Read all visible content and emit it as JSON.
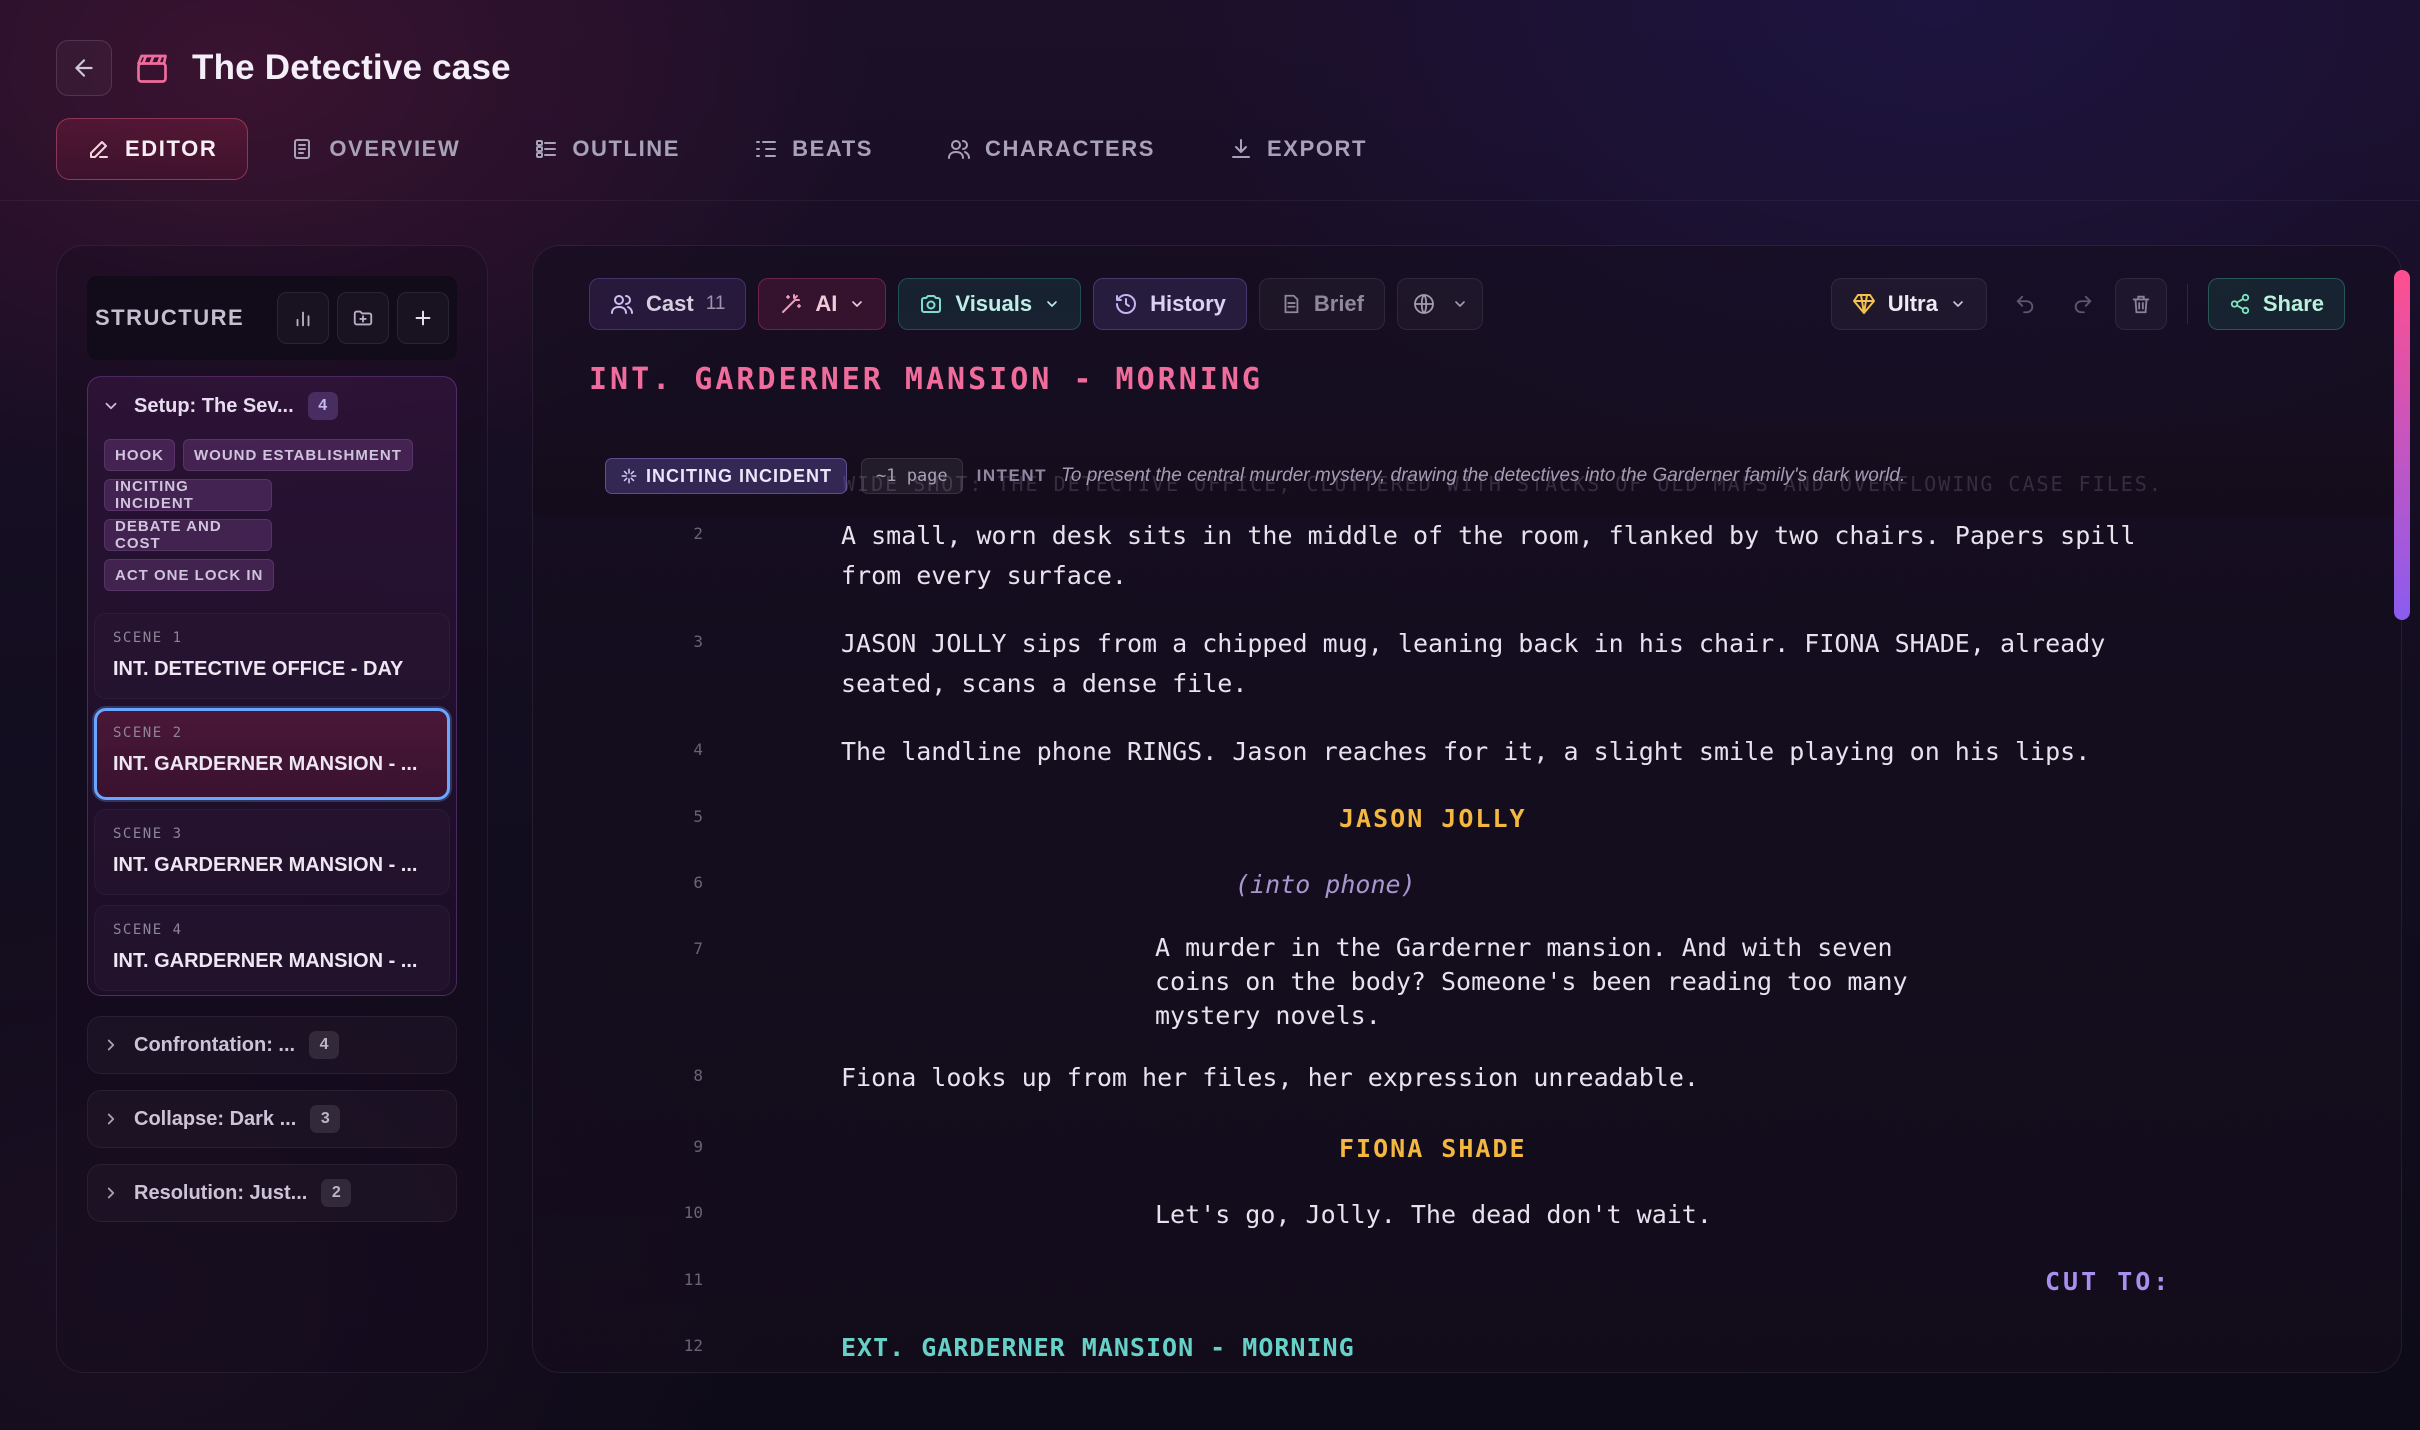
{
  "header": {
    "title": "The Detective case"
  },
  "tabs": [
    {
      "label": "EDITOR",
      "icon": "pencil-icon",
      "active": true
    },
    {
      "label": "OVERVIEW",
      "icon": "document-icon"
    },
    {
      "label": "OUTLINE",
      "icon": "list-icon"
    },
    {
      "label": "BEATS",
      "icon": "indent-list-icon"
    },
    {
      "label": "CHARACTERS",
      "icon": "users-icon"
    },
    {
      "label": "EXPORT",
      "icon": "download-icon"
    }
  ],
  "sidebar": {
    "label": "STRUCTURE",
    "open_group": {
      "title": "Setup: The Sev...",
      "count": "4",
      "beats": [
        "HOOK",
        "WOUND ESTABLISHMENT",
        "INCITING INCIDENT",
        "DEBATE AND COST",
        "ACT ONE LOCK IN"
      ],
      "scenes": [
        {
          "num": "SCENE 1",
          "title": "INT. DETECTIVE OFFICE - DAY"
        },
        {
          "num": "SCENE 2",
          "title": "INT. GARDERNER MANSION - ..."
        },
        {
          "num": "SCENE 3",
          "title": "INT. GARDERNER MANSION - ..."
        },
        {
          "num": "SCENE 4",
          "title": "INT. GARDERNER MANSION - ..."
        }
      ]
    },
    "groups": [
      {
        "title": "Confrontation: ...",
        "count": "4"
      },
      {
        "title": "Collapse: Dark ...",
        "count": "3"
      },
      {
        "title": "Resolution: Just...",
        "count": "2"
      }
    ]
  },
  "toolbar": {
    "cast_label": "Cast",
    "cast_count": "11",
    "ai_label": "AI",
    "visuals_label": "Visuals",
    "history_label": "History",
    "brief_label": "Brief",
    "ultra_label": "Ultra",
    "share_label": "Share"
  },
  "editor": {
    "scene_heading": "INT. GARDERNER MANSION - MORNING",
    "ghost_text": "WIDE SHOT: THE DETECTIVE OFFICE, CLUTTERED WITH STACKS OF OLD MAPS AND OVERFLOWING CASE FILES.",
    "beat_tag": "INCITING INCIDENT",
    "page_estimate": "~1 page",
    "intent_label": "INTENT",
    "intent_text": "To present the central murder mystery, drawing the detectives into the Garderner family's dark world.",
    "lines": [
      {
        "num": "2",
        "text": "A small, worn desk sits in the middle of the room, flanked by two chairs. Papers spill\nfrom every surface."
      },
      {
        "num": "3",
        "text": "JASON JOLLY sips from a chipped mug, leaning back in his chair. FIONA SHADE, already\nseated, scans a dense file."
      },
      {
        "num": "4",
        "text": "The landline phone RINGS. Jason reaches for it, a slight smile playing on his lips."
      },
      {
        "num": "5",
        "text": "JASON JOLLY"
      },
      {
        "num": "6",
        "text": "(into phone)"
      },
      {
        "num": "7",
        "text": "A murder in the Garderner mansion. And with seven\ncoins on the body? Someone's been reading too many\nmystery novels."
      },
      {
        "num": "8",
        "text": "Fiona looks up from her files, her expression unreadable."
      },
      {
        "num": "9",
        "text": "FIONA SHADE"
      },
      {
        "num": "10",
        "text": "Let's go, Jolly. The dead don't wait."
      },
      {
        "num": "11",
        "text": "CUT TO:"
      },
      {
        "num": "12",
        "text": "EXT. GARDERNER MANSION - MORNING"
      }
    ]
  },
  "colors": {
    "accent_pink": "#ef6c9c",
    "character_gold": "#f4b740",
    "selection_blue": "#6aa6ff",
    "heading_teal": "#67d1c8"
  }
}
